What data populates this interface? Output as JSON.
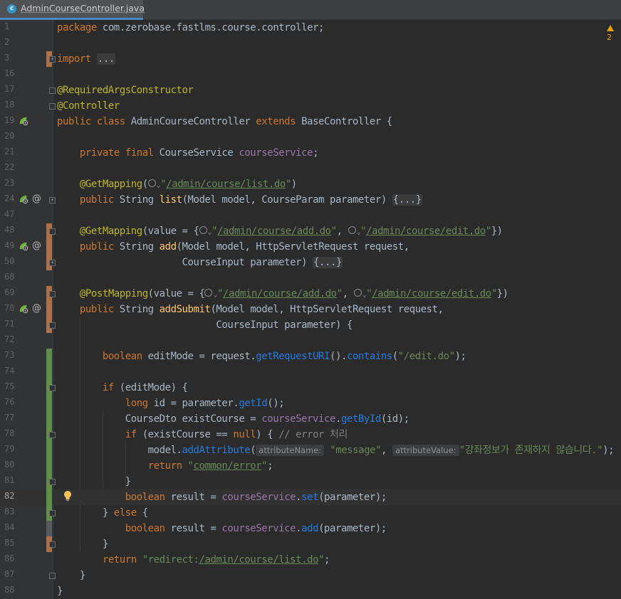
{
  "tab": {
    "icon": "class-c-icon",
    "title": "AdminCourseController.java",
    "close": "×"
  },
  "warning": {
    "count": "2"
  },
  "hints": {
    "attributeName": "attributeName:",
    "attributeValue": "attributeValue:"
  },
  "lines": [
    {
      "n": "1",
      "code": "package com.zerobase.fastlms.course.controller;"
    },
    {
      "n": "2",
      "code": ""
    },
    {
      "n": "3",
      "code": "import ..."
    },
    {
      "n": "16",
      "code": ""
    },
    {
      "n": "17",
      "code": "@RequiredArgsConstructor"
    },
    {
      "n": "18",
      "code": "@Controller"
    },
    {
      "n": "19",
      "code": "public class AdminCourseController extends BaseController {"
    },
    {
      "n": "20",
      "code": ""
    },
    {
      "n": "21",
      "code": "    private final CourseService courseService;"
    },
    {
      "n": "22",
      "code": ""
    },
    {
      "n": "23",
      "code": "    @GetMapping(\"/admin/course/list.do\")"
    },
    {
      "n": "24",
      "code": "    public String list(Model model, CourseParam parameter) {...}"
    },
    {
      "n": "47",
      "code": ""
    },
    {
      "n": "48",
      "code": "    @GetMapping(value = {\"/admin/course/add.do\", \"/admin/course/edit.do\"})"
    },
    {
      "n": "49",
      "code": "    public String add(Model model, HttpServletRequest request,"
    },
    {
      "n": "50",
      "code": "                      CourseInput parameter) {...}"
    },
    {
      "n": "68",
      "code": ""
    },
    {
      "n": "69",
      "code": "    @PostMapping(value = {\"/admin/course/add.do\", \"/admin/course/edit.do\"})"
    },
    {
      "n": "70",
      "code": "    public String addSubmit(Model model, HttpServletRequest request,"
    },
    {
      "n": "71",
      "code": "                            CourseInput parameter) {"
    },
    {
      "n": "72",
      "code": ""
    },
    {
      "n": "73",
      "code": "        boolean editMode = request.getRequestURI().contains(\"/edit.do\");"
    },
    {
      "n": "74",
      "code": ""
    },
    {
      "n": "75",
      "code": "        if (editMode) {"
    },
    {
      "n": "76",
      "code": "            long id = parameter.getId();"
    },
    {
      "n": "77",
      "code": "            CourseDto existCourse = courseService.getById(id);"
    },
    {
      "n": "78",
      "code": "            if (existCourse == null) { // error 처리"
    },
    {
      "n": "79",
      "code": "                model.addAttribute(\"message\", \"강좌정보가 존재하지 않습니다.\");"
    },
    {
      "n": "80",
      "code": "                return \"common/error\";"
    },
    {
      "n": "81",
      "code": "            }"
    },
    {
      "n": "82",
      "code": "            boolean result = courseService.set(parameter);"
    },
    {
      "n": "83",
      "code": "        } else {"
    },
    {
      "n": "84",
      "code": "            boolean result = courseService.add(parameter);"
    },
    {
      "n": "85",
      "code": "        }"
    },
    {
      "n": "86",
      "code": "        return \"redirect:/admin/course/list.do\";"
    },
    {
      "n": "87",
      "code": "    }"
    },
    {
      "n": "88",
      "code": "}"
    }
  ],
  "colors": {
    "background": "#2b2b2b",
    "gutter": "#313335",
    "keyword": "#cc7832",
    "annotation": "#bbb529",
    "string": "#6a8759",
    "field": "#9876aa",
    "method": "#ffc66d",
    "comment": "#808080",
    "vcs_modified": "#c47b4b",
    "vcs_added": "#5f8f4a"
  }
}
